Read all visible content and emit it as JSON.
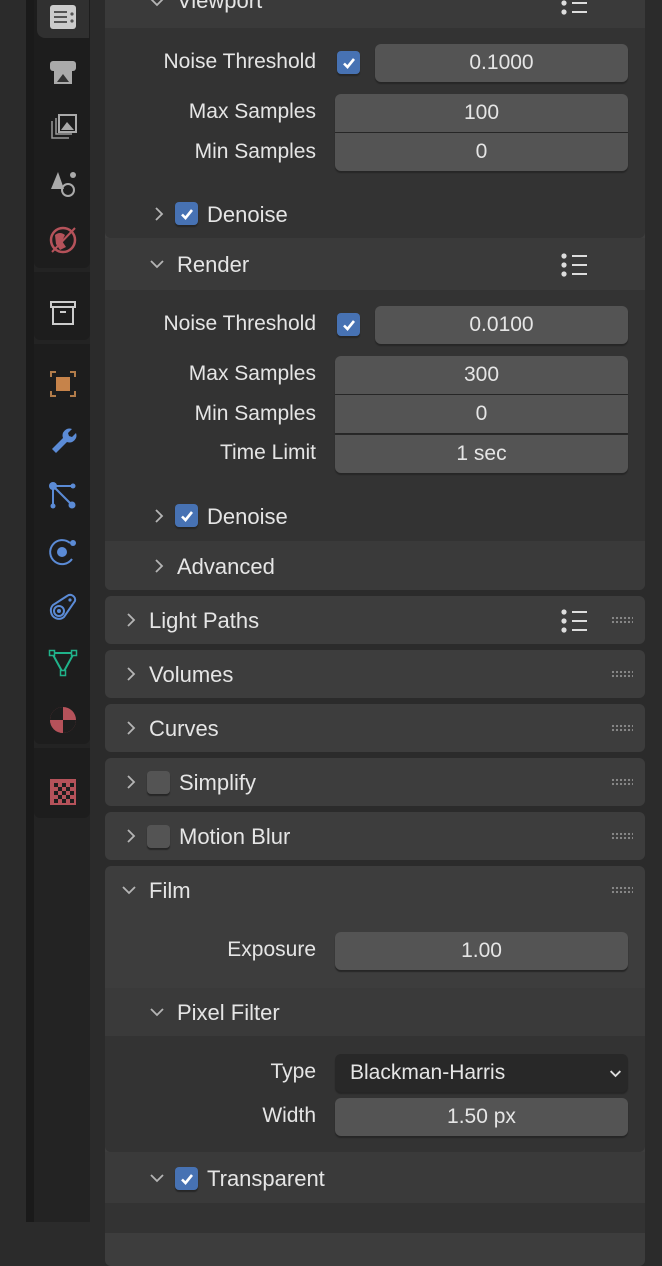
{
  "tabs": [
    {
      "icon": "tool-icon",
      "active": true
    },
    {
      "icon": "render-icon"
    },
    {
      "icon": "output-icon"
    },
    {
      "icon": "view-layer-icon"
    },
    {
      "icon": "scene-icon"
    },
    {
      "icon": "world-icon"
    },
    {
      "icon": "collection-icon"
    },
    {
      "icon": "object-icon"
    },
    {
      "icon": "modifier-wrench-icon"
    },
    {
      "icon": "particles-icon"
    },
    {
      "icon": "physics-icon"
    },
    {
      "icon": "constraints-icon"
    },
    {
      "icon": "object-data-mesh-icon"
    },
    {
      "icon": "material-icon"
    },
    {
      "icon": "texture-icon"
    }
  ],
  "viewport": {
    "title": "Viewport",
    "noise_threshold_label": "Noise Threshold",
    "noise_threshold_enabled": true,
    "noise_threshold": "0.1000",
    "max_samples_label": "Max Samples",
    "max_samples": "100",
    "min_samples_label": "Min Samples",
    "min_samples": "0",
    "denoise_label": "Denoise",
    "denoise": true
  },
  "render": {
    "title": "Render",
    "noise_threshold_label": "Noise Threshold",
    "noise_threshold_enabled": true,
    "noise_threshold": "0.0100",
    "max_samples_label": "Max Samples",
    "max_samples": "300",
    "min_samples_label": "Min Samples",
    "min_samples": "0",
    "time_limit_label": "Time Limit",
    "time_limit": "1 sec",
    "denoise_label": "Denoise",
    "denoise": true,
    "advanced_label": "Advanced"
  },
  "panels": {
    "light_paths": "Light Paths",
    "volumes": "Volumes",
    "curves": "Curves",
    "simplify": "Simplify",
    "simplify_enabled": false,
    "motion_blur": "Motion Blur",
    "motion_blur_enabled": false,
    "film": "Film"
  },
  "film": {
    "exposure_label": "Exposure",
    "exposure": "1.00",
    "pixel_filter": "Pixel Filter",
    "type_label": "Type",
    "type": "Blackman-Harris",
    "width_label": "Width",
    "width": "1.50 px",
    "transparent_label": "Transparent",
    "transparent": true
  },
  "colors": {
    "accent": "#4772b3",
    "field": "#545454",
    "panel": "#3d3d3d"
  }
}
